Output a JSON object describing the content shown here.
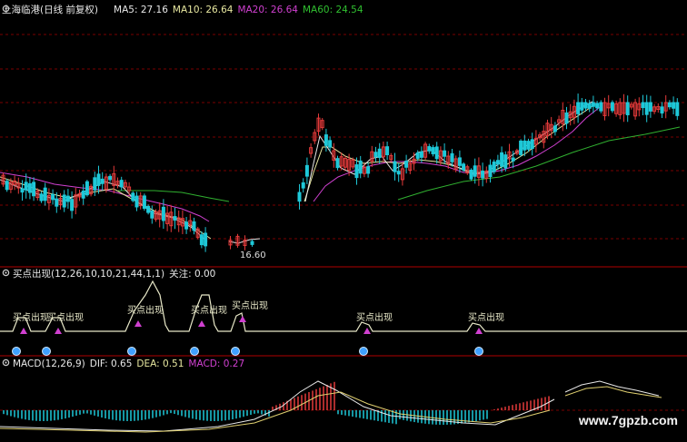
{
  "colors": {
    "up": "#e33a3a",
    "down": "#1ec8d8",
    "ma5": "#e8e8e8",
    "ma10": "#e8e8a0",
    "ma20": "#d040d0",
    "ma60": "#30b030",
    "dea": "#e0d070",
    "signal": "#e8e8c8",
    "grid": "#7a0000",
    "marker": "#d040d0"
  },
  "main": {
    "title": "上海临港(日线 前复权)",
    "ma5": "MA5: 27.16",
    "ma10": "MA10: 26.64",
    "ma20": "MA20: 26.64",
    "ma60": "MA60: 24.54",
    "low_label": "16.60"
  },
  "indicator": {
    "title": "买点出现(12,26,10,10,21,44,1,1)",
    "focus": "关注: 0.00",
    "signal_label": "买点出现"
  },
  "macd": {
    "title": "MACD(12,26,9)",
    "dif": "DIF: 0.65",
    "dea": "DEA: 0.51",
    "macd": "MACD: 0.27"
  },
  "watermark": "www.7gpzb.com"
}
